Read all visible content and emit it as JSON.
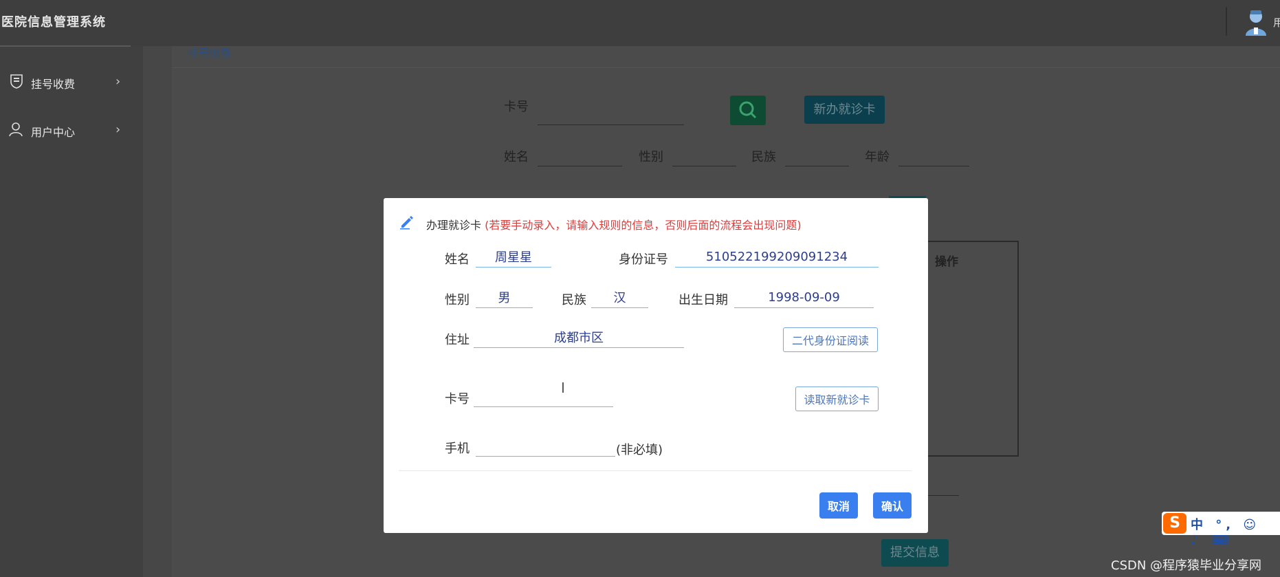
{
  "app": {
    "title": "医院信息管理系统",
    "user_text": "用"
  },
  "sidebar": {
    "items": [
      {
        "label": "挂号收费",
        "icon": "shield-icon"
      },
      {
        "label": "用户中心",
        "icon": "user-icon"
      }
    ]
  },
  "breadcrumb": "挂号收费",
  "background_form": {
    "card_label": "卡号",
    "new_card_button": "新办就诊卡",
    "name_label": "姓名",
    "gender_label": "性别",
    "ethnicity_label": "民族",
    "age_label": "年龄",
    "table_header_action": "操作",
    "submit_button": "提交信息"
  },
  "modal": {
    "title": "办理就诊卡",
    "warning": "(若要手动录入，请输入规则的信息，否则后面的流程会出现问题)",
    "fields": {
      "name": {
        "label": "姓名",
        "value": "周星星"
      },
      "id_number": {
        "label": "身份证号",
        "value": "510522199209091234"
      },
      "gender": {
        "label": "性别",
        "value": "男"
      },
      "ethnicity": {
        "label": "民族",
        "value": "汉"
      },
      "birthdate": {
        "label": "出生日期",
        "value": "1998-09-09"
      },
      "address": {
        "label": "住址",
        "value": "成都市区"
      },
      "card_number": {
        "label": "卡号",
        "value": ""
      },
      "phone": {
        "label": "手机",
        "value": "",
        "hint": "(非必填)"
      }
    },
    "read_id_button": "二代身份证阅读",
    "read_card_button": "读取新就诊卡",
    "cancel_button": "取消",
    "confirm_button": "确认"
  },
  "ime": {
    "logo": "S",
    "items": "中 °, ☺ ♪ ⌨"
  },
  "watermark": "CSDN @程序猿毕业分享网",
  "colors": {
    "primary": "#3a7ff0",
    "warning": "#e03b3b",
    "input_underline": "#7ab3e6",
    "overlay": "#4b4b4b"
  }
}
